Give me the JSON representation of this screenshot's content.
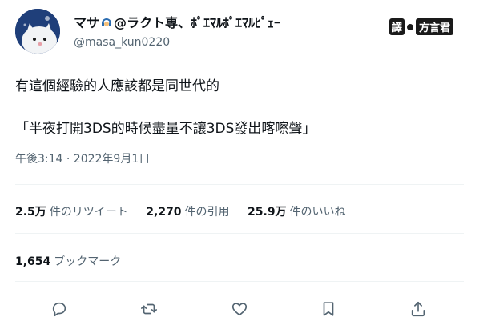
{
  "author": {
    "name_part1": "マサ",
    "name_part2": "@ラクト専、ﾎﾟｴﾏﾙﾎﾟｴﾏﾙﾋﾟｪｰ",
    "handle": "@masa_kun0220",
    "avatar_icon": "cat-avatar-icon",
    "headset_icon": "headset-emoji-icon"
  },
  "overlay": {
    "label_a": "譯",
    "label_b": "方言君"
  },
  "tweet": {
    "line1": "有這個經驗的人應該都是同世代的",
    "line2": "「半夜打開3DS的時候盡量不讓3DS發出喀嚓聲」",
    "timestamp": "午後3:14 · 2022年9月1日"
  },
  "stats": {
    "retweets_count": "2.5万",
    "retweets_label": "件のリツイート",
    "quotes_count": "2,270",
    "quotes_label": "件の引用",
    "likes_count": "25.9万",
    "likes_label": "件のいいね",
    "bookmarks_count": "1,654",
    "bookmarks_label": "ブックマーク"
  },
  "colors": {
    "text_primary": "#0f1419",
    "text_secondary": "#536471",
    "divider": "#eff3f4",
    "icon": "#536471",
    "avatar_bg": "#1f3f7a"
  },
  "actions": [
    {
      "icon": "reply-icon"
    },
    {
      "icon": "retweet-icon"
    },
    {
      "icon": "like-heart-icon"
    },
    {
      "icon": "bookmark-icon"
    },
    {
      "icon": "share-icon"
    }
  ]
}
